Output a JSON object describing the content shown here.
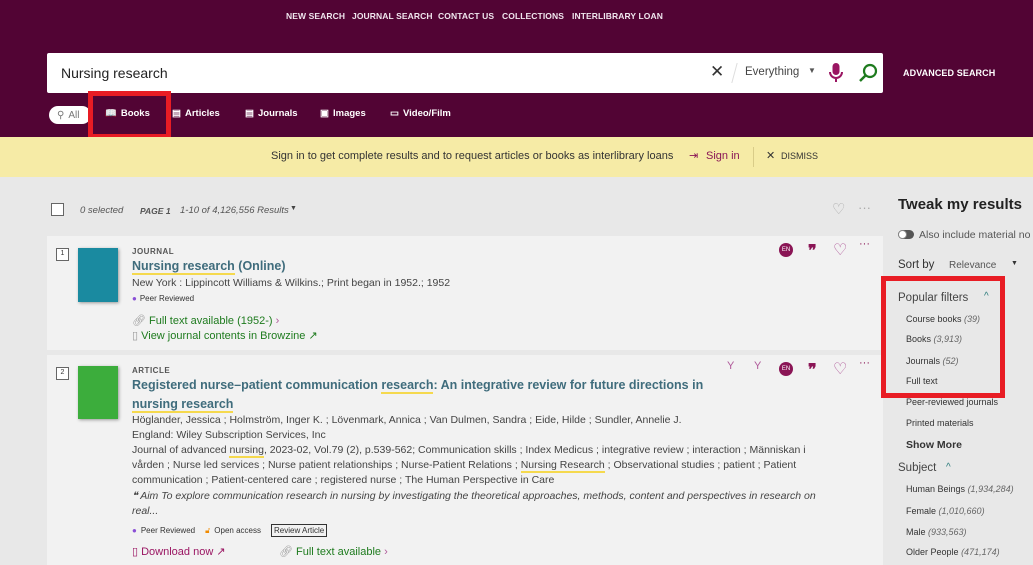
{
  "topnav": [
    "NEW SEARCH",
    "JOURNAL SEARCH",
    "CONTACT US",
    "COLLECTIONS",
    "INTERLIBRARY LOAN"
  ],
  "search": {
    "query": "Nursing research",
    "scope": "Everything",
    "advanced": "ADVANCED SEARCH"
  },
  "tabs": [
    "All",
    "Books",
    "Articles",
    "Journals",
    "Images",
    "Video/Film"
  ],
  "banner": {
    "message": "Sign in to get complete results and to request articles or books as interlibrary loans",
    "signin": "Sign in",
    "dismiss": "DISMISS"
  },
  "toolbar": {
    "selected": "0 selected",
    "page": "PAGE 1",
    "results": "1-10 of 4,126,556 Results"
  },
  "results": [
    {
      "num": "1",
      "type": "JOURNAL",
      "title_hl": "Nursing research",
      "title_rest": " (Online)",
      "publisher": "New York : Lippincott Williams & Wilkins.; Print began in 1952.; 1952",
      "peer": "Peer Reviewed",
      "fulltext": "Full text available (1952-)",
      "browzine": "View journal contents in Browzine",
      "lang": "EN"
    },
    {
      "num": "2",
      "type": "ARTICLE",
      "title_a": "Registered nurse–patient communication ",
      "title_hl1": "research",
      "title_b": ": An integrative review for future directions in ",
      "title_hl2": "nursing research",
      "authors": "Höglander, Jessica ; Holmström, Inger K. ; Lövenmark, Annica ; Van Dulmen, Sandra ; Eide, Hilde ; Sundler, Annelie J.",
      "publisher": "England: Wiley Subscription Services, Inc",
      "source_a": "Journal of advanced ",
      "source_hl": "nursing",
      "source_b": ", 2023-02, Vol.79 (2), p.539-562; Communication skills ; Index Medicus ; integrative review ; interaction ; Människan i vården ; Nurse led services ; Nurse patient relationships ; Nurse-Patient Relations ; ",
      "source_hl2": "Nursing Research",
      "source_c": " ; Observational studies ; patient ; Patient communication ; Patient-centered care ; registered nurse ; The Human Perspective in Care",
      "abstract": "Aim To explore communication research in nursing by investigating the theoretical approaches, methods, content and perspectives in research on real...",
      "peer": "Peer Reviewed",
      "open": "Open access",
      "review": "Review Article",
      "download": "Download now",
      "fulltext": "Full text available",
      "lang": "EN"
    }
  ],
  "sidebar": {
    "title": "Tweak my results",
    "include": "Also include material no",
    "sortby": "Sort by",
    "sort_value": "Relevance",
    "popular_title": "Popular filters",
    "popular": [
      {
        "label": "Course books",
        "count": "(39)"
      },
      {
        "label": "Books",
        "count": "(3,913)"
      },
      {
        "label": "Journals",
        "count": "(52)"
      },
      {
        "label": "Full text",
        "count": ""
      },
      {
        "label": "Peer-reviewed journals",
        "count": ""
      },
      {
        "label": "Printed materials",
        "count": ""
      }
    ],
    "show_more": "Show More",
    "subject_title": "Subject",
    "subjects": [
      {
        "label": "Human Beings",
        "count": "(1,934,284)"
      },
      {
        "label": "Female",
        "count": "(1,010,660)"
      },
      {
        "label": "Male",
        "count": "(933,563)"
      },
      {
        "label": "Older People",
        "count": "(471,174)"
      }
    ]
  },
  "colors": {
    "header": "#520434",
    "banner": "#f6eba6",
    "highlight_box": "#e81c24",
    "title": "#3f6c7c",
    "link_green": "#1e7b1e"
  }
}
